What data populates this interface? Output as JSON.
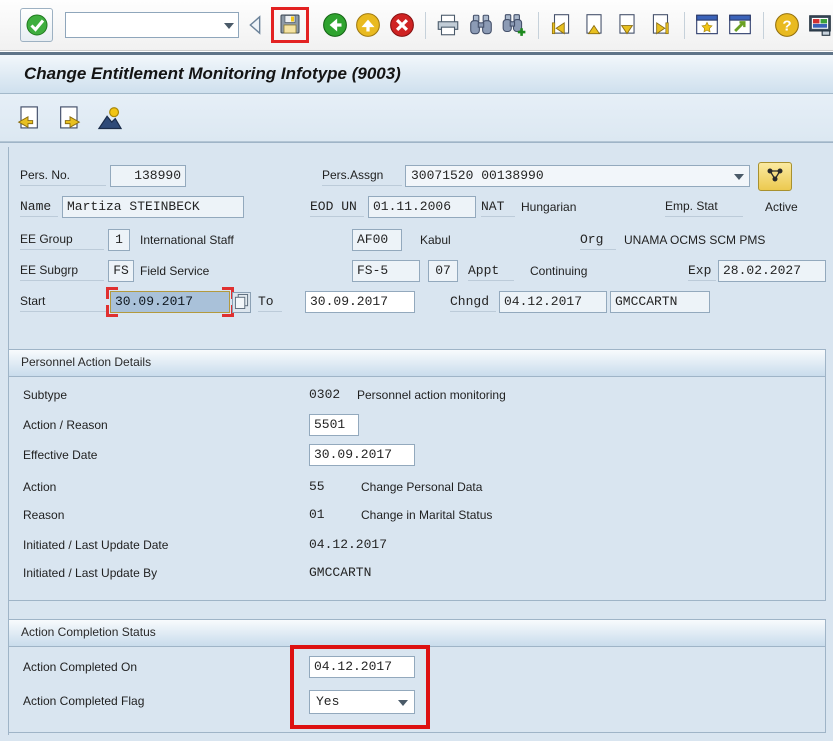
{
  "colors": {
    "content_bg": "#d9e5f0",
    "annotation_red": "#dd1111",
    "selected_field_bg": "#a9c1d9",
    "org_button_yellow": "#ecc94f"
  },
  "toolbar": {
    "command_value": "",
    "icon_names": [
      "enter-icon",
      "command-field",
      "collapse-icon",
      "save-icon",
      "back-icon",
      "exit-icon",
      "cancel-icon",
      "print-icon",
      "find-icon",
      "find-next-icon",
      "first-page-icon",
      "previous-page-icon",
      "next-page-icon",
      "last-page-icon",
      "new-session-icon",
      "shortcut-icon",
      "help-icon",
      "customize-icon"
    ]
  },
  "title_bar": {
    "title": "Change Entitlement Monitoring Infotype (9003)"
  },
  "app_toolbar": {
    "icon_names": [
      "previous-record-icon",
      "next-record-icon",
      "employee-icon"
    ]
  },
  "header": {
    "pers_no": {
      "label": "Pers. No.",
      "value": "138990"
    },
    "pers_assgn": {
      "label": "Pers.Assgn",
      "value": "30071520 00138990"
    },
    "name": {
      "label": "Name",
      "value": "Martiza STEINBECK"
    },
    "eod": {
      "label": "EOD UN",
      "value": "01.11.2006"
    },
    "nat": {
      "label": "NAT",
      "value": "Hungarian"
    },
    "emp_stat": {
      "label": "Emp. Stat",
      "value": "Active"
    },
    "ee_group": {
      "label": "EE Group",
      "code": "1",
      "text": "International Staff"
    },
    "duty_station": {
      "code": "AF00",
      "text": "Kabul"
    },
    "org": {
      "label": "Org",
      "value": "UNAMA OCMS SCM PMS"
    },
    "ee_subgrp": {
      "label": "EE Subgrp",
      "code": "FS",
      "text": "Field Service"
    },
    "grade": "FS-5",
    "level": "07",
    "appt": {
      "label": "Appt",
      "value": "Continuing"
    },
    "exp": {
      "label": "Exp",
      "value": "28.02.2027"
    },
    "start": {
      "label": "Start",
      "value": "30.09.2017"
    },
    "to": {
      "label": "To",
      "value": "30.09.2017"
    },
    "chngd": {
      "label": "Chngd",
      "date": "04.12.2017",
      "by": "GMCCARTN"
    }
  },
  "personnel_action_details": {
    "title": "Personnel Action Details",
    "subtype": {
      "label": "Subtype",
      "code": "0302",
      "text": "Personnel action monitoring"
    },
    "action_reason": {
      "label": "Action / Reason",
      "value": "5501"
    },
    "effective_date": {
      "label": "Effective Date",
      "value": "30.09.2017"
    },
    "action": {
      "label": "Action",
      "code": "55",
      "text": "Change Personal Data"
    },
    "reason": {
      "label": "Reason",
      "code": "01",
      "text": "Change in Marital Status"
    },
    "init_date": {
      "label": "Initiated / Last Update Date",
      "value": "04.12.2017"
    },
    "init_by": {
      "label": "Initiated / Last Update By",
      "value": "GMCCARTN"
    }
  },
  "action_completion": {
    "title": "Action Completion Status",
    "completed_on": {
      "label": "Action Completed On",
      "value": "04.12.2017"
    },
    "completed_flag": {
      "label": "Action Completed Flag",
      "value": "Yes"
    }
  }
}
